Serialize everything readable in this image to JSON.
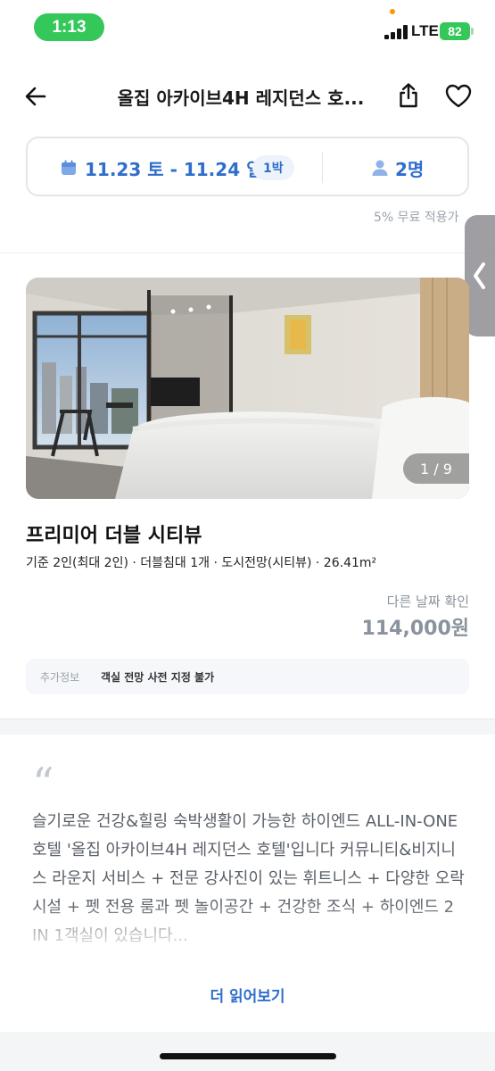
{
  "status_bar": {
    "time": "1:13",
    "network": "LTE",
    "battery": "82"
  },
  "header": {
    "title": "올집 아카이브4H 레지던스 호..."
  },
  "booking": {
    "dates": "11.23 토 - 11.24 일",
    "nights": "1박",
    "guests": "2명"
  },
  "cutoff_text": "5% 무료 적용가",
  "room": {
    "photo_counter": "1 / 9",
    "name": "프리미어 더블 시티뷰",
    "spec": "기준 2인(최대 2인) · 더블침대 1개 · 도시전망(시티뷰) · 26.41m²",
    "other_date_label": "다른 날짜 확인",
    "price": "114,000원",
    "extra_info_label": "추가정보",
    "extra_info_value": "객실 전망 사전 지정 불가"
  },
  "description": {
    "quote": "“",
    "text": "슬기로운 건강&힐링 숙박생활이 가능한 하이엔드 ALL-IN-ONE 호텔 '올집 아카이브4H 레지던스 호텔'입니다 커뮤니티&비지니스 라운지 서비스 + 전문 강사진이 있는 휘트니스 + 다양한 오락시설 + 펫 전용 룸과 펫 놀이공간 + 건강한 조식 + 하이엔드 2 IN 1객실이 있습니다...",
    "read_more": "더 읽어보기"
  },
  "colors": {
    "accent": "#2f6ecb",
    "status_green": "#34c759",
    "muted": "#8a939d"
  },
  "icons": [
    "back-arrow-icon",
    "share-icon",
    "heart-icon",
    "calendar-icon",
    "person-icon",
    "chevron-left-icon"
  ]
}
